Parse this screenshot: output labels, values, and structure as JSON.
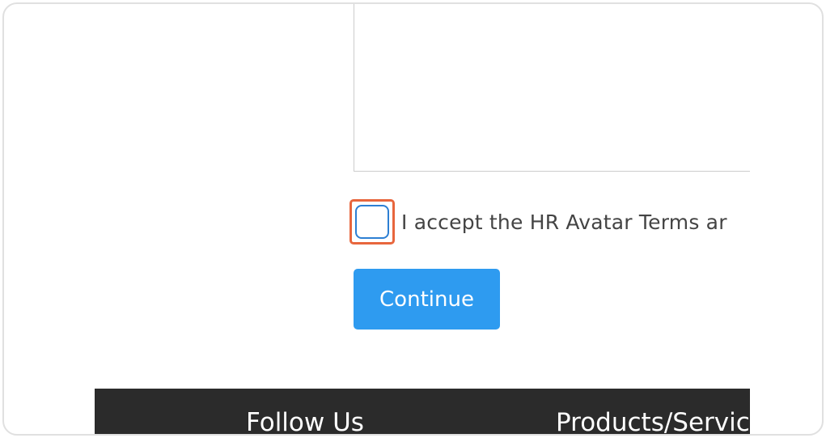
{
  "form": {
    "terms_text": "I accept the HR Avatar Terms ar",
    "terms_checked": false,
    "continue_label": "Continue"
  },
  "footer": {
    "follow_heading": "Follow Us",
    "products_heading": "Products/Servic"
  },
  "colors": {
    "primary_button": "#2e9bf0",
    "highlight_border": "#e8663d",
    "footer_background": "#2b2b2b"
  }
}
